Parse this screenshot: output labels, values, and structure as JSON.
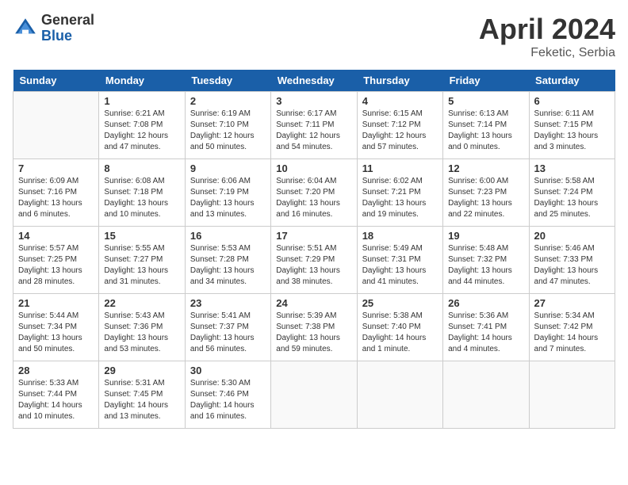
{
  "header": {
    "logo_general": "General",
    "logo_blue": "Blue",
    "title": "April 2024",
    "subtitle": "Feketic, Serbia"
  },
  "weekdays": [
    "Sunday",
    "Monday",
    "Tuesday",
    "Wednesday",
    "Thursday",
    "Friday",
    "Saturday"
  ],
  "weeks": [
    [
      {
        "day": "",
        "info": ""
      },
      {
        "day": "1",
        "info": "Sunrise: 6:21 AM\nSunset: 7:08 PM\nDaylight: 12 hours\nand 47 minutes."
      },
      {
        "day": "2",
        "info": "Sunrise: 6:19 AM\nSunset: 7:10 PM\nDaylight: 12 hours\nand 50 minutes."
      },
      {
        "day": "3",
        "info": "Sunrise: 6:17 AM\nSunset: 7:11 PM\nDaylight: 12 hours\nand 54 minutes."
      },
      {
        "day": "4",
        "info": "Sunrise: 6:15 AM\nSunset: 7:12 PM\nDaylight: 12 hours\nand 57 minutes."
      },
      {
        "day": "5",
        "info": "Sunrise: 6:13 AM\nSunset: 7:14 PM\nDaylight: 13 hours\nand 0 minutes."
      },
      {
        "day": "6",
        "info": "Sunrise: 6:11 AM\nSunset: 7:15 PM\nDaylight: 13 hours\nand 3 minutes."
      }
    ],
    [
      {
        "day": "7",
        "info": "Sunrise: 6:09 AM\nSunset: 7:16 PM\nDaylight: 13 hours\nand 6 minutes."
      },
      {
        "day": "8",
        "info": "Sunrise: 6:08 AM\nSunset: 7:18 PM\nDaylight: 13 hours\nand 10 minutes."
      },
      {
        "day": "9",
        "info": "Sunrise: 6:06 AM\nSunset: 7:19 PM\nDaylight: 13 hours\nand 13 minutes."
      },
      {
        "day": "10",
        "info": "Sunrise: 6:04 AM\nSunset: 7:20 PM\nDaylight: 13 hours\nand 16 minutes."
      },
      {
        "day": "11",
        "info": "Sunrise: 6:02 AM\nSunset: 7:21 PM\nDaylight: 13 hours\nand 19 minutes."
      },
      {
        "day": "12",
        "info": "Sunrise: 6:00 AM\nSunset: 7:23 PM\nDaylight: 13 hours\nand 22 minutes."
      },
      {
        "day": "13",
        "info": "Sunrise: 5:58 AM\nSunset: 7:24 PM\nDaylight: 13 hours\nand 25 minutes."
      }
    ],
    [
      {
        "day": "14",
        "info": "Sunrise: 5:57 AM\nSunset: 7:25 PM\nDaylight: 13 hours\nand 28 minutes."
      },
      {
        "day": "15",
        "info": "Sunrise: 5:55 AM\nSunset: 7:27 PM\nDaylight: 13 hours\nand 31 minutes."
      },
      {
        "day": "16",
        "info": "Sunrise: 5:53 AM\nSunset: 7:28 PM\nDaylight: 13 hours\nand 34 minutes."
      },
      {
        "day": "17",
        "info": "Sunrise: 5:51 AM\nSunset: 7:29 PM\nDaylight: 13 hours\nand 38 minutes."
      },
      {
        "day": "18",
        "info": "Sunrise: 5:49 AM\nSunset: 7:31 PM\nDaylight: 13 hours\nand 41 minutes."
      },
      {
        "day": "19",
        "info": "Sunrise: 5:48 AM\nSunset: 7:32 PM\nDaylight: 13 hours\nand 44 minutes."
      },
      {
        "day": "20",
        "info": "Sunrise: 5:46 AM\nSunset: 7:33 PM\nDaylight: 13 hours\nand 47 minutes."
      }
    ],
    [
      {
        "day": "21",
        "info": "Sunrise: 5:44 AM\nSunset: 7:34 PM\nDaylight: 13 hours\nand 50 minutes."
      },
      {
        "day": "22",
        "info": "Sunrise: 5:43 AM\nSunset: 7:36 PM\nDaylight: 13 hours\nand 53 minutes."
      },
      {
        "day": "23",
        "info": "Sunrise: 5:41 AM\nSunset: 7:37 PM\nDaylight: 13 hours\nand 56 minutes."
      },
      {
        "day": "24",
        "info": "Sunrise: 5:39 AM\nSunset: 7:38 PM\nDaylight: 13 hours\nand 59 minutes."
      },
      {
        "day": "25",
        "info": "Sunrise: 5:38 AM\nSunset: 7:40 PM\nDaylight: 14 hours\nand 1 minute."
      },
      {
        "day": "26",
        "info": "Sunrise: 5:36 AM\nSunset: 7:41 PM\nDaylight: 14 hours\nand 4 minutes."
      },
      {
        "day": "27",
        "info": "Sunrise: 5:34 AM\nSunset: 7:42 PM\nDaylight: 14 hours\nand 7 minutes."
      }
    ],
    [
      {
        "day": "28",
        "info": "Sunrise: 5:33 AM\nSunset: 7:44 PM\nDaylight: 14 hours\nand 10 minutes."
      },
      {
        "day": "29",
        "info": "Sunrise: 5:31 AM\nSunset: 7:45 PM\nDaylight: 14 hours\nand 13 minutes."
      },
      {
        "day": "30",
        "info": "Sunrise: 5:30 AM\nSunset: 7:46 PM\nDaylight: 14 hours\nand 16 minutes."
      },
      {
        "day": "",
        "info": ""
      },
      {
        "day": "",
        "info": ""
      },
      {
        "day": "",
        "info": ""
      },
      {
        "day": "",
        "info": ""
      }
    ]
  ]
}
